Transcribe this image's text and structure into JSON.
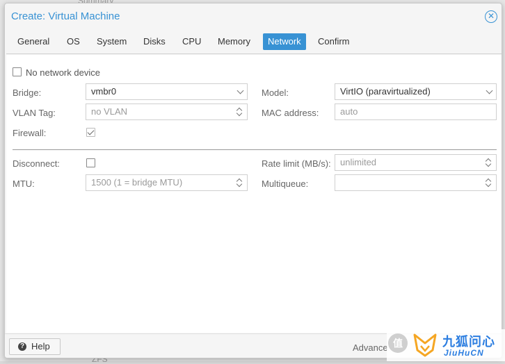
{
  "background": {
    "text_top": "Summary",
    "text_bottom": "ZFS"
  },
  "dialog": {
    "title": "Create: Virtual Machine",
    "close_glyph": "✕"
  },
  "tabs": [
    {
      "label": "General",
      "active": false
    },
    {
      "label": "OS",
      "active": false
    },
    {
      "label": "System",
      "active": false
    },
    {
      "label": "Disks",
      "active": false
    },
    {
      "label": "CPU",
      "active": false
    },
    {
      "label": "Memory",
      "active": false
    },
    {
      "label": "Network",
      "active": true
    },
    {
      "label": "Confirm",
      "active": false
    }
  ],
  "form": {
    "no_network_device": {
      "label": "No network device",
      "checked": false
    },
    "bridge": {
      "label": "Bridge:",
      "value": "vmbr0"
    },
    "vlan_tag": {
      "label": "VLAN Tag:",
      "placeholder": "no VLAN"
    },
    "firewall": {
      "label": "Firewall:",
      "checked": true
    },
    "model": {
      "label": "Model:",
      "value": "VirtIO (paravirtualized)"
    },
    "mac_address": {
      "label": "MAC address:",
      "placeholder": "auto"
    },
    "disconnect": {
      "label": "Disconnect:",
      "checked": false
    },
    "mtu": {
      "label": "MTU:",
      "placeholder": "1500 (1 = bridge MTU)"
    },
    "rate_limit": {
      "label": "Rate limit (MB/s):",
      "placeholder": "unlimited"
    },
    "multiqueue": {
      "label": "Multiqueue:",
      "value": ""
    }
  },
  "footer": {
    "help_label": "Help",
    "help_icon_glyph": "?",
    "advanced_label": "Advance"
  },
  "watermark": {
    "logo_glyph": "值",
    "line1": "九狐问心",
    "line2": "JiuHuCN"
  },
  "colors": {
    "accent": "#3892d4",
    "watermark_blue": "#2b7de0",
    "watermark_orange": "#f5a623"
  }
}
